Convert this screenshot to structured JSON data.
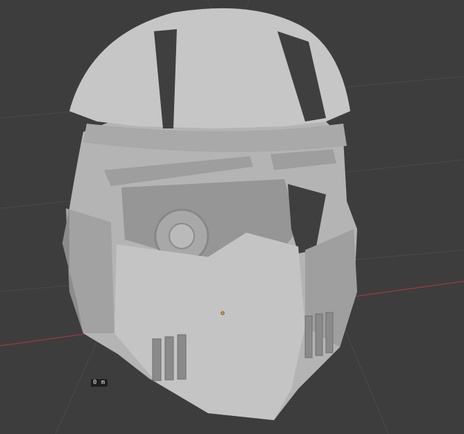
{
  "viewport": {
    "background": "#3d3d3d",
    "grid_color": "#4a4a4a",
    "x_axis_color": "#9b3b40",
    "model_base_color": "#bdbdbd",
    "model_shadow_color": "#8c8c8c",
    "origin_color": "#e0a020",
    "model_icon": "helmet-mesh",
    "distance_readout": "0 m"
  }
}
